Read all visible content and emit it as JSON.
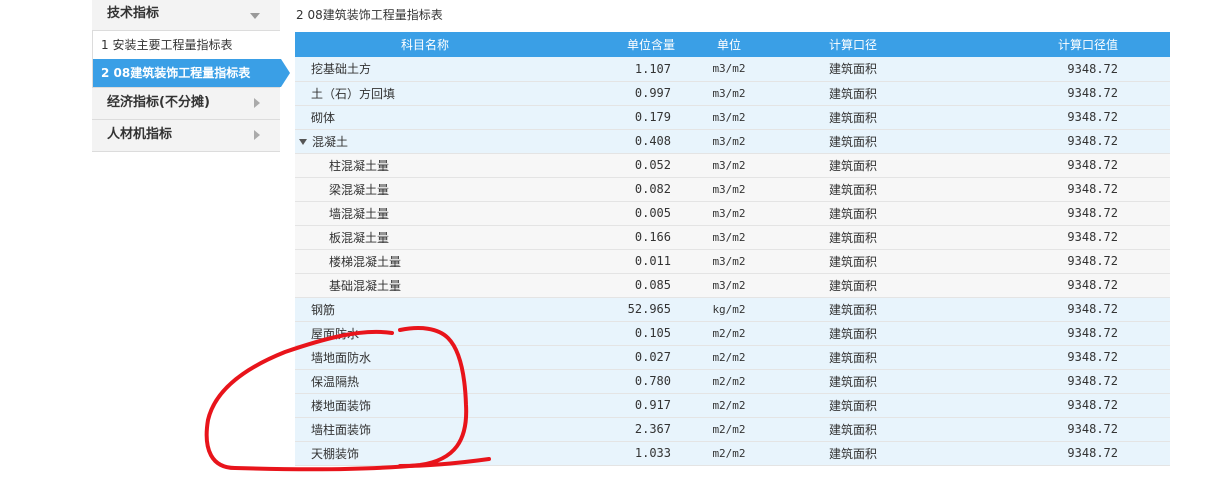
{
  "sidebar": {
    "sections": [
      {
        "label": "技术指标"
      },
      {
        "label": "经济指标(不分摊)"
      },
      {
        "label": "人材机指标"
      }
    ],
    "sub_items": [
      {
        "label": "1 安装主要工程量指标表"
      },
      {
        "label": "2 08建筑装饰工程量指标表"
      }
    ]
  },
  "main": {
    "title": "2 08建筑装饰工程量指标表"
  },
  "table": {
    "headers": [
      "科目名称",
      "单位含量",
      "单位",
      "计算口径",
      "计算口径值"
    ],
    "rows": [
      {
        "name": "挖基础土方",
        "qty": "1.107",
        "unit": "m3/m2",
        "basis": "建筑面积",
        "value": "9348.72"
      },
      {
        "name": "土（石）方回填",
        "qty": "0.997",
        "unit": "m3/m2",
        "basis": "建筑面积",
        "value": "9348.72"
      },
      {
        "name": "砌体",
        "qty": "0.179",
        "unit": "m3/m2",
        "basis": "建筑面积",
        "value": "9348.72"
      },
      {
        "name": "混凝土",
        "qty": "0.408",
        "unit": "m3/m2",
        "basis": "建筑面积",
        "value": "9348.72"
      },
      {
        "name": "柱混凝土量",
        "qty": "0.052",
        "unit": "m3/m2",
        "basis": "建筑面积",
        "value": "9348.72"
      },
      {
        "name": "梁混凝土量",
        "qty": "0.082",
        "unit": "m3/m2",
        "basis": "建筑面积",
        "value": "9348.72"
      },
      {
        "name": "墙混凝土量",
        "qty": "0.005",
        "unit": "m3/m2",
        "basis": "建筑面积",
        "value": "9348.72"
      },
      {
        "name": "板混凝土量",
        "qty": "0.166",
        "unit": "m3/m2",
        "basis": "建筑面积",
        "value": "9348.72"
      },
      {
        "name": "楼梯混凝土量",
        "qty": "0.011",
        "unit": "m3/m2",
        "basis": "建筑面积",
        "value": "9348.72"
      },
      {
        "name": "基础混凝土量",
        "qty": "0.085",
        "unit": "m3/m2",
        "basis": "建筑面积",
        "value": "9348.72"
      },
      {
        "name": "钢筋",
        "qty": "52.965",
        "unit": "kg/m2",
        "basis": "建筑面积",
        "value": "9348.72"
      },
      {
        "name": "屋面防水",
        "qty": "0.105",
        "unit": "m2/m2",
        "basis": "建筑面积",
        "value": "9348.72"
      },
      {
        "name": "墙地面防水",
        "qty": "0.027",
        "unit": "m2/m2",
        "basis": "建筑面积",
        "value": "9348.72"
      },
      {
        "name": "保温隔热",
        "qty": "0.780",
        "unit": "m2/m2",
        "basis": "建筑面积",
        "value": "9348.72"
      },
      {
        "name": "楼地面装饰",
        "qty": "0.917",
        "unit": "m2/m2",
        "basis": "建筑面积",
        "value": "9348.72"
      },
      {
        "name": "墙柱面装饰",
        "qty": "2.367",
        "unit": "m2/m2",
        "basis": "建筑面积",
        "value": "9348.72"
      },
      {
        "name": "天棚装饰",
        "qty": "1.033",
        "unit": "m2/m2",
        "basis": "建筑面积",
        "value": "9348.72"
      }
    ]
  },
  "colors": {
    "accent": "#3a9fe6",
    "annotation": "#e8141b"
  }
}
